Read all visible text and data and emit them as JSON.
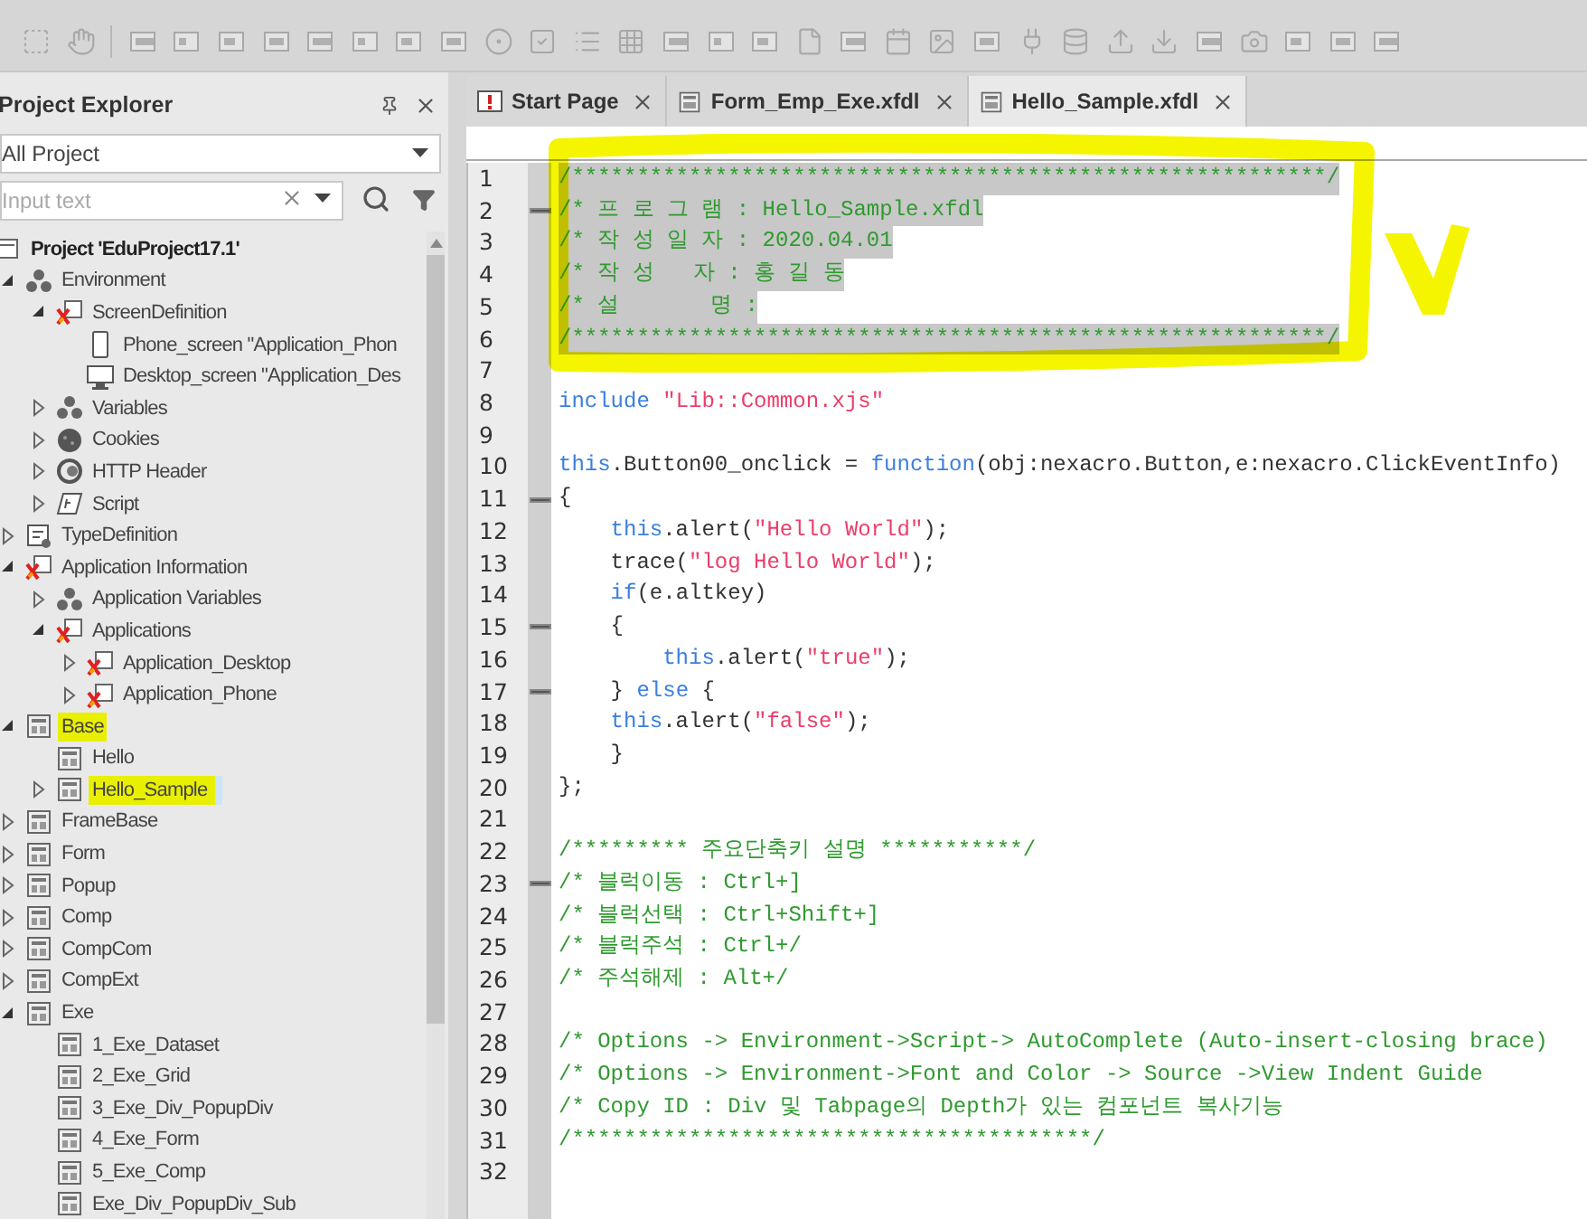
{
  "explorer": {
    "title": "Project Explorer",
    "filter": {
      "value": "All Project"
    },
    "search": {
      "placeholder": "Input text"
    },
    "tree": [
      {
        "label": "Project 'EduProject17.1'",
        "kind": "project",
        "children": [
          {
            "label": "Environment",
            "kind": "cluster",
            "expanded": true,
            "children": [
              {
                "label": "ScreenDefinition",
                "kind": "red",
                "expanded": true,
                "children": [
                  {
                    "label": "Phone_screen \"Application_Phon",
                    "kind": "phone"
                  },
                  {
                    "label": "Desktop_screen \"Application_Des",
                    "kind": "desktop"
                  }
                ]
              },
              {
                "label": "Variables",
                "kind": "cluster",
                "expanded": false
              },
              {
                "label": "Cookies",
                "kind": "cookie",
                "expanded": false
              },
              {
                "label": "HTTP Header",
                "kind": "http",
                "expanded": false
              },
              {
                "label": "Script",
                "kind": "script",
                "expanded": false
              }
            ]
          },
          {
            "label": "TypeDefinition",
            "kind": "typedef",
            "expanded": false
          },
          {
            "label": "Application Information",
            "kind": "red",
            "expanded": true,
            "children": [
              {
                "label": "Application Variables",
                "kind": "cluster",
                "expanded": false
              },
              {
                "label": "Applications",
                "kind": "red",
                "expanded": true,
                "children": [
                  {
                    "label": "Application_Desktop",
                    "kind": "red",
                    "expanded": false
                  },
                  {
                    "label": "Application_Phone",
                    "kind": "red",
                    "expanded": false
                  }
                ]
              }
            ]
          },
          {
            "label": "Base",
            "kind": "form",
            "expanded": true,
            "highlighted": true,
            "selected": false,
            "children": [
              {
                "label": "Hello",
                "kind": "form",
                "highlighted": false,
                "selected": false
              },
              {
                "label": "Hello_Sample",
                "kind": "form",
                "expanded": false,
                "highlighted": true,
                "selected": true
              }
            ]
          },
          {
            "label": "FrameBase",
            "kind": "form",
            "expanded": false
          },
          {
            "label": "Form",
            "kind": "form",
            "expanded": false
          },
          {
            "label": "Popup",
            "kind": "form",
            "expanded": false
          },
          {
            "label": "Comp",
            "kind": "form",
            "expanded": false
          },
          {
            "label": "CompCom",
            "kind": "form",
            "expanded": false
          },
          {
            "label": "CompExt",
            "kind": "form",
            "expanded": false
          },
          {
            "label": "Exe",
            "kind": "form",
            "expanded": true,
            "children": [
              {
                "label": "1_Exe_Dataset",
                "kind": "form"
              },
              {
                "label": "2_Exe_Grid",
                "kind": "form"
              },
              {
                "label": "3_Exe_Div_PopupDiv",
                "kind": "form"
              },
              {
                "label": "4_Exe_Form",
                "kind": "form"
              },
              {
                "label": "5_Exe_Comp",
                "kind": "form"
              },
              {
                "label": "Exe_Div_PopupDiv_Sub",
                "kind": "form"
              }
            ]
          }
        ]
      }
    ]
  },
  "tabs": [
    {
      "label": "Start Page",
      "kind": "start",
      "selected": false
    },
    {
      "label": "Form_Emp_Exe.xfdl",
      "kind": "form",
      "selected": false
    },
    {
      "label": "Hello_Sample.xfdl",
      "kind": "form",
      "selected": true
    }
  ],
  "code": [
    {
      "number": "1",
      "selected": true,
      "tokens": [
        {
          "kind": "comment",
          "text": "/**********************************************************/"
        }
      ]
    },
    {
      "number": "2",
      "fold": true,
      "selected": true,
      "tokens": [
        {
          "kind": "comment",
          "text": "/* 프 로 그 램 : Hello_Sample.xfdl"
        }
      ]
    },
    {
      "number": "3",
      "selected": true,
      "tokens": [
        {
          "kind": "comment",
          "text": "/* 작 성 일 자 : 2020.04.01"
        }
      ]
    },
    {
      "number": "4",
      "selected": true,
      "tokens": [
        {
          "kind": "comment",
          "text": "/* 작 성   자 : 홍 길 동"
        }
      ]
    },
    {
      "number": "5",
      "selected": true,
      "tokens": [
        {
          "kind": "comment",
          "text": "/* 설       명 :"
        }
      ]
    },
    {
      "number": "6",
      "selected": true,
      "tokens": [
        {
          "kind": "comment",
          "text": "/**********************************************************/"
        }
      ]
    },
    {
      "number": "7"
    },
    {
      "number": "8",
      "tokens": [
        {
          "kind": "keyword",
          "text": "include"
        },
        {
          "kind": "string",
          "text": " \"Lib::Common.xjs\""
        }
      ]
    },
    {
      "number": "9"
    },
    {
      "number": "10",
      "tokens": [
        {
          "kind": "keyword",
          "text": "this"
        },
        {
          "kind": "plain",
          "text": ".Button00_onclick = "
        },
        {
          "kind": "keyword",
          "text": "function"
        },
        {
          "kind": "plain",
          "text": "(obj:nexacro.Button,e:nexacro.ClickEventInfo)"
        }
      ]
    },
    {
      "number": "11",
      "fold": true,
      "tokens": [
        {
          "kind": "plain",
          "text": "{"
        }
      ]
    },
    {
      "number": "12",
      "tokens": [
        {
          "kind": "keyword",
          "text": "    this"
        },
        {
          "kind": "plain",
          "text": ".alert("
        },
        {
          "kind": "string",
          "text": "\"Hello World\""
        },
        {
          "kind": "plain",
          "text": ");"
        }
      ]
    },
    {
      "number": "13",
      "tokens": [
        {
          "kind": "plain",
          "text": "    trace("
        },
        {
          "kind": "string",
          "text": "\"log Hello World\""
        },
        {
          "kind": "plain",
          "text": ");"
        }
      ]
    },
    {
      "number": "14",
      "tokens": [
        {
          "kind": "keyword",
          "text": "    if"
        },
        {
          "kind": "plain",
          "text": "(e.altkey)"
        }
      ]
    },
    {
      "number": "15",
      "fold": true,
      "tokens": [
        {
          "kind": "plain",
          "text": "    {"
        }
      ]
    },
    {
      "number": "16",
      "tokens": [
        {
          "kind": "keyword",
          "text": "        this"
        },
        {
          "kind": "plain",
          "text": ".alert("
        },
        {
          "kind": "string",
          "text": "\"true\""
        },
        {
          "kind": "plain",
          "text": ");"
        }
      ]
    },
    {
      "number": "17",
      "fold": true,
      "tokens": [
        {
          "kind": "plain",
          "text": "    } "
        },
        {
          "kind": "keyword",
          "text": "else"
        },
        {
          "kind": "plain",
          "text": " {"
        }
      ]
    },
    {
      "number": "18",
      "tokens": [
        {
          "kind": "keyword",
          "text": "    this"
        },
        {
          "kind": "plain",
          "text": ".alert("
        },
        {
          "kind": "string",
          "text": "\"false\""
        },
        {
          "kind": "plain",
          "text": ");"
        }
      ]
    },
    {
      "number": "19",
      "tokens": [
        {
          "kind": "plain",
          "text": "    }"
        }
      ]
    },
    {
      "number": "20",
      "tokens": [
        {
          "kind": "plain",
          "text": "};"
        }
      ]
    },
    {
      "number": "21"
    },
    {
      "number": "22",
      "tokens": [
        {
          "kind": "comment",
          "text": "/********* 주요단축키 설명 ***********/"
        }
      ]
    },
    {
      "number": "23",
      "fold": true,
      "tokens": [
        {
          "kind": "comment",
          "text": "/* 블럭이동 : Ctrl+]"
        }
      ]
    },
    {
      "number": "24",
      "tokens": [
        {
          "kind": "comment",
          "text": "/* 블럭선택 : Ctrl+Shift+]"
        }
      ]
    },
    {
      "number": "25",
      "tokens": [
        {
          "kind": "comment",
          "text": "/* 블럭주석 : Ctrl+/"
        }
      ]
    },
    {
      "number": "26",
      "tokens": [
        {
          "kind": "comment",
          "text": "/* 주석해제 : Alt+/"
        }
      ]
    },
    {
      "number": "27"
    },
    {
      "number": "28",
      "tokens": [
        {
          "kind": "comment",
          "text": "/* Options -> Environment->Script-> AutoComplete (Auto-insert-closing brace)"
        }
      ]
    },
    {
      "number": "29",
      "tokens": [
        {
          "kind": "comment",
          "text": "/* Options -> Environment->Font and Color -> Source ->View Indent Guide"
        }
      ]
    },
    {
      "number": "30",
      "tokens": [
        {
          "kind": "comment",
          "text": "/* Copy ID : Div 및 Tabpage의 Depth가 있는 컴포넌트 복사기능"
        }
      ]
    },
    {
      "number": "31",
      "tokens": [
        {
          "kind": "comment",
          "text": "/****************************************/"
        }
      ]
    },
    {
      "number": "32"
    }
  ]
}
